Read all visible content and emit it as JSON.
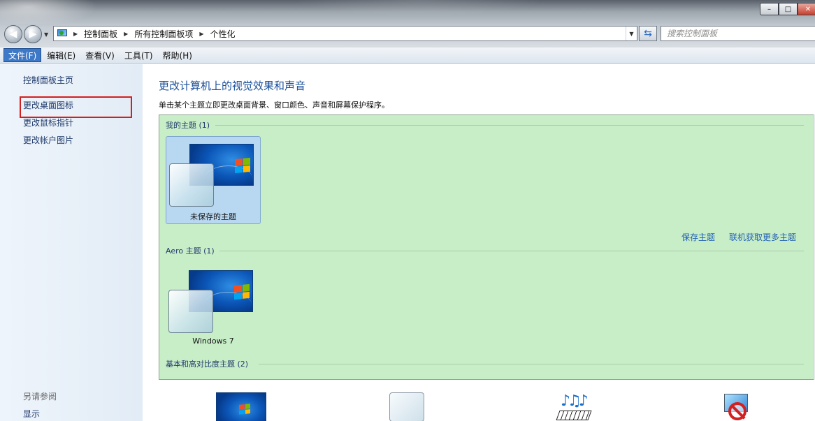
{
  "window": {
    "controls": {
      "minimize": "–",
      "maximize": "□",
      "close": "✕"
    }
  },
  "navigation": {
    "back_icon": "back-arrow-icon",
    "forward_icon": "forward-arrow-icon",
    "breadcrumbs": [
      "控制面板",
      "所有控制面板项",
      "个性化"
    ],
    "search_placeholder": "搜索控制面板"
  },
  "menu": {
    "items": [
      "文件(F)",
      "编辑(E)",
      "查看(V)",
      "工具(T)",
      "帮助(H)"
    ],
    "active_index": 0
  },
  "sidebar": {
    "home": "控制面板主页",
    "links": [
      "更改桌面图标",
      "更改鼠标指针",
      "更改帐户图片"
    ],
    "see_also_title": "另请参阅",
    "see_also_links": [
      "显示"
    ]
  },
  "main": {
    "title": "更改计算机上的视觉效果和声音",
    "description": "单击某个主题立即更改桌面背景、窗口颜色、声音和屏幕保护程序。",
    "groups": {
      "my_themes": "我的主题 (1)",
      "aero_themes": "Aero 主题 (1)",
      "basic_themes": "基本和高对比度主题 (2)"
    },
    "themes": {
      "unsaved": "未保存的主题",
      "windows7": "Windows 7"
    },
    "actions": {
      "save": "保存主题",
      "more_online": "联机获取更多主题"
    }
  },
  "colors": {
    "accent": "#1a4f9a",
    "theme_panel_bg": "#c8eec8",
    "highlight_box": "#d21f1f",
    "menu_active": "#3e79c8"
  }
}
